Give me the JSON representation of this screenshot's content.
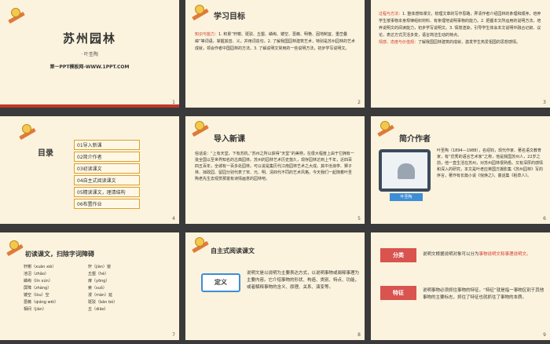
{
  "slide1": {
    "title": "苏州园林",
    "author": "· 叶圣陶",
    "footer": "第一PPT模板网-WWW.1PPT.COM",
    "num": "1"
  },
  "slide2": {
    "title": "学习目标",
    "label": "知识与能力：",
    "body": "1. 积累“轩榭、斑驳、丘壑、嶙峋、镂空、蔷薇、明艳、因地制宜、重峦叠嶂”等词语，掌握其音、义，并用词造句。2. 了解我国园林建筑艺术，特别是苏州园林的艺术成就，领会作者中国园林的方法。3. 了解说明文常用的一些说明方法，初步学写说明文。",
    "num": "2"
  },
  "slide3": {
    "label1": "过程与方法：",
    "body1": "1. 整体感知课文，梳理文章的写作思路，弄清作者介绍园林的条理和顺序，培养学生按事物本身规律组织材料、有条理地说明事物的能力。2. 把握本文所运用的说明方法，培养说明文的阅读能力，初步学写说明文。3. 情境渲染，引导学生体会本文说明中融合记叙、议论，表达方式灵活多变，语言简洁生动的特点。",
    "label2": "情感、态度与价值观：",
    "body2": "了解我国园林建筑的成就，激发学生热爱祖国的思想感情。",
    "num": "3"
  },
  "slide4": {
    "heading": "目录",
    "items": [
      "01导入新课",
      "02简介作者",
      "03初读课文",
      "04自主式阅读课文",
      "05精读课文，理清结构",
      "06布置作业"
    ],
    "num": "4"
  },
  "slide5": {
    "title": "导入新课",
    "body": "俗话说：“上有天堂，下有苏杭。”苏州之所以获得“天堂”的美称，在很大程度上由于它拥有一批全国以至世界知名的古典园林。苏州的园林艺术历史悠久，现存园林达到上千年，近四百四五百年，全城有一百多处园林。可以说是集历代江南园林艺术之大成。其中沧浪亭、狮子林、拙政园、留园分别代表了宋、元、明、清四代不同的艺术风格。今天我们一起随着叶圣陶老先生去观赏那富有诗情画意的园林吧。",
    "num": "5"
  },
  "slide6": {
    "title": "简介作者",
    "caption": "叶圣陶",
    "body": "叶圣陶（1894—1988），名绍钧，现代作家、著名语文教育家，有“优秀的语言艺术家”之称，他是我国苏州人，22岁之前，他一直生活在苏州，对苏州园林很熟悉。又有深厚的感情和深入的研究，本文是叶老应英国方摄影集《苏州园林》写的序言，著作有长篇小说《倪焕之》，童话集《稻草人》。",
    "num": "6"
  },
  "slide7": {
    "title": "初读课文，扫除字词障碍",
    "left": [
      "轩榭（xuān xiè）",
      "池沼（zhǎo）",
      "嶙峋（lín xún）",
      "屏障（zhàng）",
      "镂空（lòu）空",
      "蔷薇（qiáng wēi）",
      "相间（jiàn）"
    ],
    "right": [
      "轩（jiàn）窗",
      "丘壑（hè）",
      "扉（yōng）",
      "索（suǒ）",
      "漫（màn）延",
      "斑驳（bān bó）",
      "丘（diāo）"
    ],
    "num": "7"
  },
  "slide8": {
    "title": "自主式阅读课文",
    "tag": "定义",
    "body": "说明文是以说明为主要表达方式，以说明事物或阐释事理为主要内容。它介绍事物的形状、构造、类别、特点、功能，或者解释事物的含义、原理、关系、演变等。",
    "num": "8"
  },
  "slide9": {
    "tag1": "分类",
    "body1a": "说明文根据说明对象可以分为",
    "body1b": "事物说明文和事理说明文。",
    "tag2": "特征",
    "body2": "说明事物必须抓住事物的特征。“特征”就是指一事物区别于其他事物的主要标志，抓住了特征也就抓住了事物的本质。",
    "num": "9"
  },
  "colors": {
    "accent": "#c0392b",
    "tag": "#d9534f",
    "cream": "#fbf3dd"
  },
  "icons": [
    "pencil-mascot-icon",
    "tablet-icon"
  ]
}
